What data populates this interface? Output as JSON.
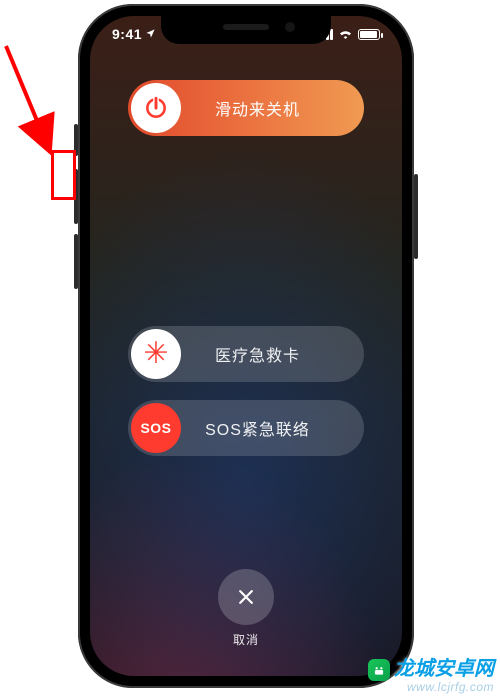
{
  "status": {
    "time": "9:41"
  },
  "power_off": {
    "label": "滑动来关机"
  },
  "medical": {
    "label": "医疗急救卡",
    "knob_text": "✳"
  },
  "sos": {
    "label": "SOS紧急联络",
    "knob_text": "SOS"
  },
  "cancel": {
    "label": "取消"
  },
  "watermark": {
    "title": "龙城安卓网",
    "url": "www.lcjrfg.com"
  },
  "colors": {
    "accent_red": "#ff3b30",
    "gradient_start": "#e04a2b",
    "gradient_end": "#f09a52"
  }
}
